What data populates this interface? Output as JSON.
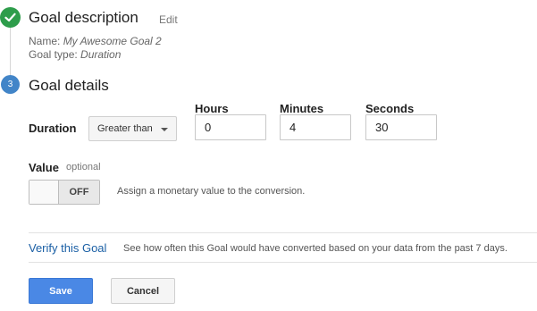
{
  "step1": {
    "title": "Goal description",
    "edit_label": "Edit",
    "name_label": "Name:",
    "name_value": "My Awesome Goal 2",
    "type_label": "Goal type:",
    "type_value": "Duration"
  },
  "step2": {
    "number": "3",
    "title": "Goal details"
  },
  "duration": {
    "label": "Duration",
    "comparison": "Greater than",
    "hours_label": "Hours",
    "hours_value": "0",
    "minutes_label": "Minutes",
    "minutes_value": "4",
    "seconds_label": "Seconds",
    "seconds_value": "30"
  },
  "value": {
    "label": "Value",
    "optional_label": "optional",
    "toggle_state": "OFF",
    "hint": "Assign a monetary value to the conversion."
  },
  "verify": {
    "link_label": "Verify this Goal",
    "description": "See how often this Goal would have converted based on your data from the past 7 days."
  },
  "actions": {
    "save_label": "Save",
    "cancel_label": "Cancel"
  },
  "colors": {
    "done_green": "#2e9d4b",
    "step_blue": "#4285c8",
    "link_blue": "#1a5fa5",
    "save_blue": "#4a88e5"
  }
}
